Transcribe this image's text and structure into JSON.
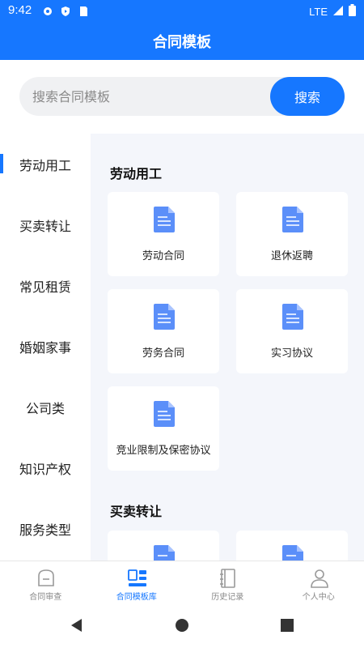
{
  "status": {
    "time": "9:42",
    "network": "LTE"
  },
  "header": {
    "title": "合同模板"
  },
  "search": {
    "placeholder": "搜索合同模板",
    "button_label": "搜索"
  },
  "categories": [
    {
      "label": "劳动用工",
      "active": true
    },
    {
      "label": "买卖转让"
    },
    {
      "label": "常见租赁"
    },
    {
      "label": "婚姻家事"
    },
    {
      "label": "公司类"
    },
    {
      "label": "知识产权"
    },
    {
      "label": "服务类型"
    }
  ],
  "sections": [
    {
      "title": "劳动用工",
      "templates": [
        "劳动合同",
        "退休返聘",
        "劳务合同",
        "实习协议",
        "竞业限制及保密协议"
      ]
    },
    {
      "title": "买卖转让",
      "templates": []
    }
  ],
  "tabs": [
    {
      "label": "合同审查",
      "icon": "contract-review-icon"
    },
    {
      "label": "合同模板库",
      "icon": "template-library-icon",
      "active": true
    },
    {
      "label": "历史记录",
      "icon": "history-icon"
    },
    {
      "label": "个人中心",
      "icon": "person-icon"
    }
  ],
  "colors": {
    "accent": "#1677ff",
    "content_bg": "#f4f6fb",
    "doc_icon": "#5b8ff9"
  }
}
